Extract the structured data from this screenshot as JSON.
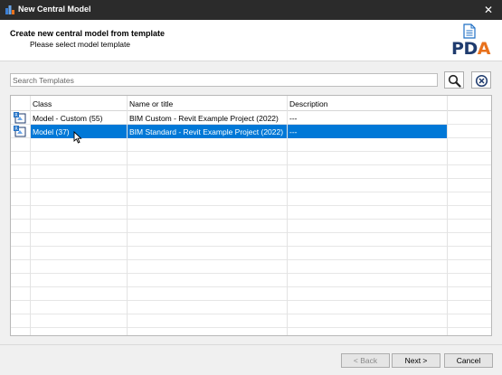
{
  "window": {
    "title": "New Central Model",
    "close_glyph": "✕"
  },
  "header": {
    "title": "Create new central model from template",
    "subtitle": "Please select model template",
    "logo_text": {
      "p": "P",
      "d": "D",
      "a": "A"
    }
  },
  "search": {
    "placeholder": "Search Templates",
    "value": ""
  },
  "grid": {
    "columns": [
      "Class",
      "Name or title",
      "Description"
    ],
    "rows": [
      {
        "class": "Model - Custom (55)",
        "name": "BIM Custom - Revit Example Project (2022)",
        "description": "---",
        "icon": "revit-model-icon",
        "selected": false
      },
      {
        "class": "Model (37)",
        "name": "BIM Standard - Revit Example Project (2022)",
        "description": "---",
        "icon": "revit-model-icon",
        "selected": true
      }
    ]
  },
  "buttons": {
    "back": "< Back",
    "next": "Next >",
    "cancel": "Cancel"
  },
  "colors": {
    "selection": "#0078d7",
    "titlebar": "#2b2b2b",
    "logo_blue": "#1f3b6e",
    "logo_orange": "#e8711c"
  }
}
